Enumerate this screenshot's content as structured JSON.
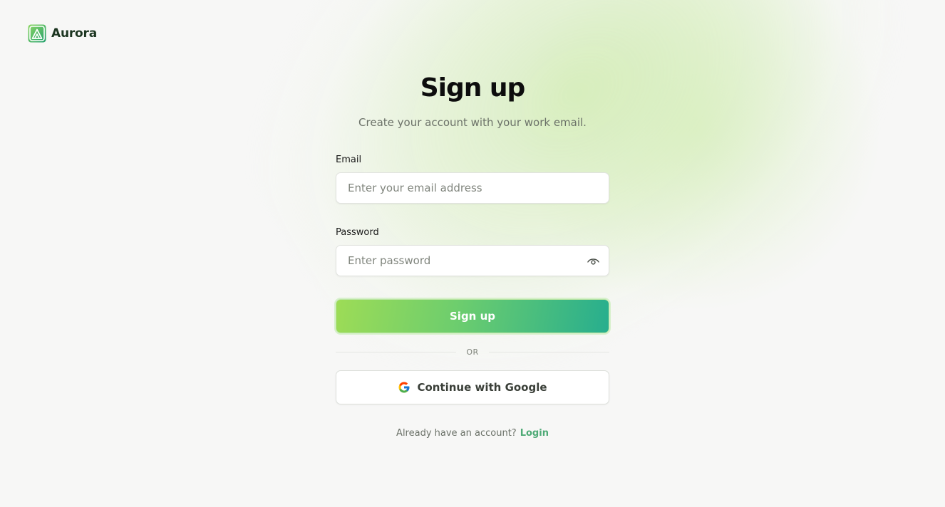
{
  "brand": {
    "name": "Aurora",
    "logo_icon": "aurora-logo-icon",
    "accent": "#3cb371"
  },
  "form": {
    "title": "Sign up",
    "subtitle": "Create your account with your work email.",
    "email": {
      "label": "Email",
      "placeholder": "Enter your email address",
      "value": ""
    },
    "password": {
      "label": "Password",
      "placeholder": "Enter password",
      "value": "",
      "toggle_icon": "eye-icon"
    },
    "submit_label": "Sign up",
    "divider_text": "OR",
    "google": {
      "label": "Continue with Google",
      "icon": "google-icon"
    },
    "footer": {
      "prompt": "Already have an account?",
      "link_label": "Login"
    }
  },
  "colors": {
    "button_gradient_start": "#9ddc56",
    "button_gradient_end": "#27ae8e",
    "link": "#4eaa76",
    "background": "#f7f7f6"
  }
}
